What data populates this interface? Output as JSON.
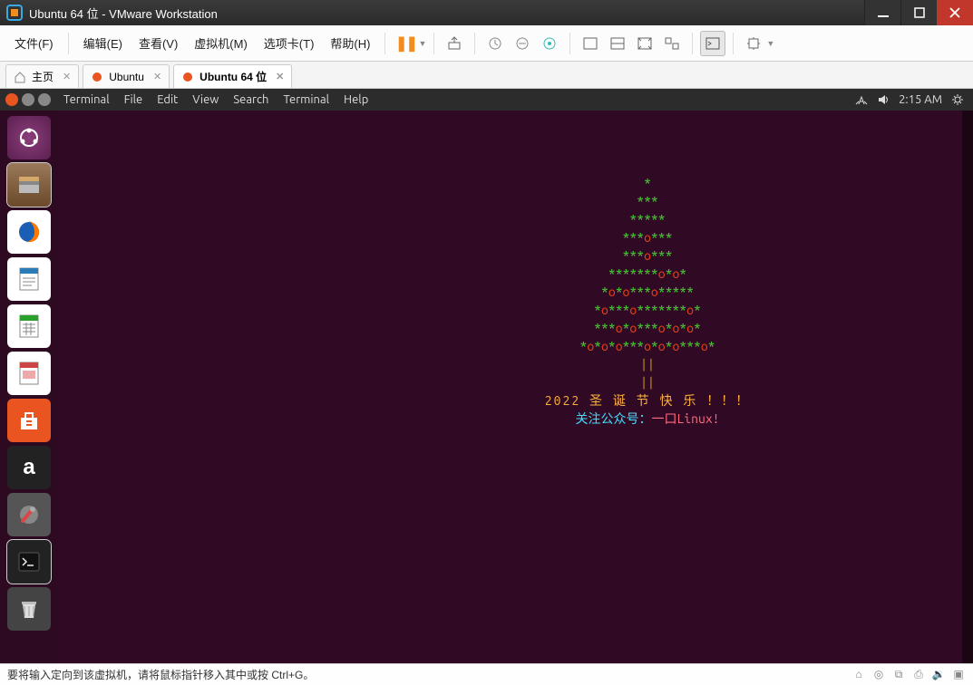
{
  "window": {
    "title": "Ubuntu 64 位 - VMware Workstation"
  },
  "vmware_menu": {
    "file": "文件(F)",
    "edit": "编辑(E)",
    "view": "查看(V)",
    "vm": "虚拟机(M)",
    "tabs": "选项卡(T)",
    "help": "帮助(H)"
  },
  "vmware_tabs": [
    {
      "label": "主页",
      "icon": "home",
      "active": false
    },
    {
      "label": "Ubuntu",
      "icon": "ubuntu",
      "active": false
    },
    {
      "label": "Ubuntu 64 位",
      "icon": "ubuntu",
      "active": true
    }
  ],
  "ubuntu_menu": {
    "terminal": "Terminal",
    "file": "File",
    "edit": "Edit",
    "view": "View",
    "search": "Search",
    "terminal2": "Terminal",
    "help": "Help",
    "time": "2:15 AM"
  },
  "launcher": [
    {
      "name": "dash",
      "icon": "◉"
    },
    {
      "name": "files",
      "icon": "🗂"
    },
    {
      "name": "firefox",
      "icon": "🦊"
    },
    {
      "name": "writer",
      "icon": "📄"
    },
    {
      "name": "calc",
      "icon": "📊"
    },
    {
      "name": "impress",
      "icon": "📽"
    },
    {
      "name": "software",
      "icon": "🛍"
    },
    {
      "name": "amazon",
      "icon": "a"
    },
    {
      "name": "settings",
      "icon": "🔧"
    },
    {
      "name": "terminal",
      "icon": ">_"
    },
    {
      "name": "trash",
      "icon": "🗑"
    }
  ],
  "tree": {
    "lines": [
      [
        {
          "c": "g",
          "t": "*"
        }
      ],
      [
        {
          "c": "g",
          "t": "***"
        }
      ],
      [
        {
          "c": "g",
          "t": "*****"
        }
      ],
      [
        {
          "c": "g",
          "t": "***"
        },
        {
          "c": "r",
          "t": "o"
        },
        {
          "c": "g",
          "t": "***"
        }
      ],
      [
        {
          "c": "g",
          "t": "***"
        },
        {
          "c": "r",
          "t": "o"
        },
        {
          "c": "g",
          "t": "***"
        }
      ],
      [
        {
          "c": "g",
          "t": "*******"
        },
        {
          "c": "r",
          "t": "o"
        },
        {
          "c": "g",
          "t": "*"
        },
        {
          "c": "r",
          "t": "o"
        },
        {
          "c": "g",
          "t": "*"
        }
      ],
      [
        {
          "c": "g",
          "t": "*"
        },
        {
          "c": "r",
          "t": "o"
        },
        {
          "c": "g",
          "t": "*"
        },
        {
          "c": "r",
          "t": "o"
        },
        {
          "c": "g",
          "t": "***"
        },
        {
          "c": "r",
          "t": "o"
        },
        {
          "c": "g",
          "t": "*****"
        }
      ],
      [
        {
          "c": "g",
          "t": "*"
        },
        {
          "c": "r",
          "t": "o"
        },
        {
          "c": "g",
          "t": "***"
        },
        {
          "c": "r",
          "t": "o"
        },
        {
          "c": "g",
          "t": "*******"
        },
        {
          "c": "r",
          "t": "o"
        },
        {
          "c": "g",
          "t": "*"
        }
      ],
      [
        {
          "c": "g",
          "t": "***"
        },
        {
          "c": "r",
          "t": "o"
        },
        {
          "c": "g",
          "t": "*"
        },
        {
          "c": "r",
          "t": "o"
        },
        {
          "c": "g",
          "t": "***"
        },
        {
          "c": "r",
          "t": "o"
        },
        {
          "c": "g",
          "t": "*"
        },
        {
          "c": "r",
          "t": "o"
        },
        {
          "c": "g",
          "t": "*"
        },
        {
          "c": "r",
          "t": "o"
        },
        {
          "c": "g",
          "t": "*"
        }
      ],
      [
        {
          "c": "g",
          "t": "*"
        },
        {
          "c": "r",
          "t": "o"
        },
        {
          "c": "g",
          "t": "*"
        },
        {
          "c": "r",
          "t": "o"
        },
        {
          "c": "g",
          "t": "*"
        },
        {
          "c": "r",
          "t": "o"
        },
        {
          "c": "g",
          "t": "***"
        },
        {
          "c": "r",
          "t": "o"
        },
        {
          "c": "g",
          "t": "*"
        },
        {
          "c": "r",
          "t": "o"
        },
        {
          "c": "g",
          "t": "*"
        },
        {
          "c": "r",
          "t": "o"
        },
        {
          "c": "g",
          "t": "***"
        },
        {
          "c": "r",
          "t": "o"
        },
        {
          "c": "g",
          "t": "*"
        }
      ]
    ],
    "trunk1": "||",
    "trunk2": "||",
    "msg1": "2022 圣 诞 节 快 乐 ！！！",
    "msg2a": "关注公众号：",
    "msg2b": "一口Linux!"
  },
  "status": {
    "hint": "要将输入定向到该虚拟机，请将鼠标指针移入其中或按 Ctrl+G。"
  }
}
